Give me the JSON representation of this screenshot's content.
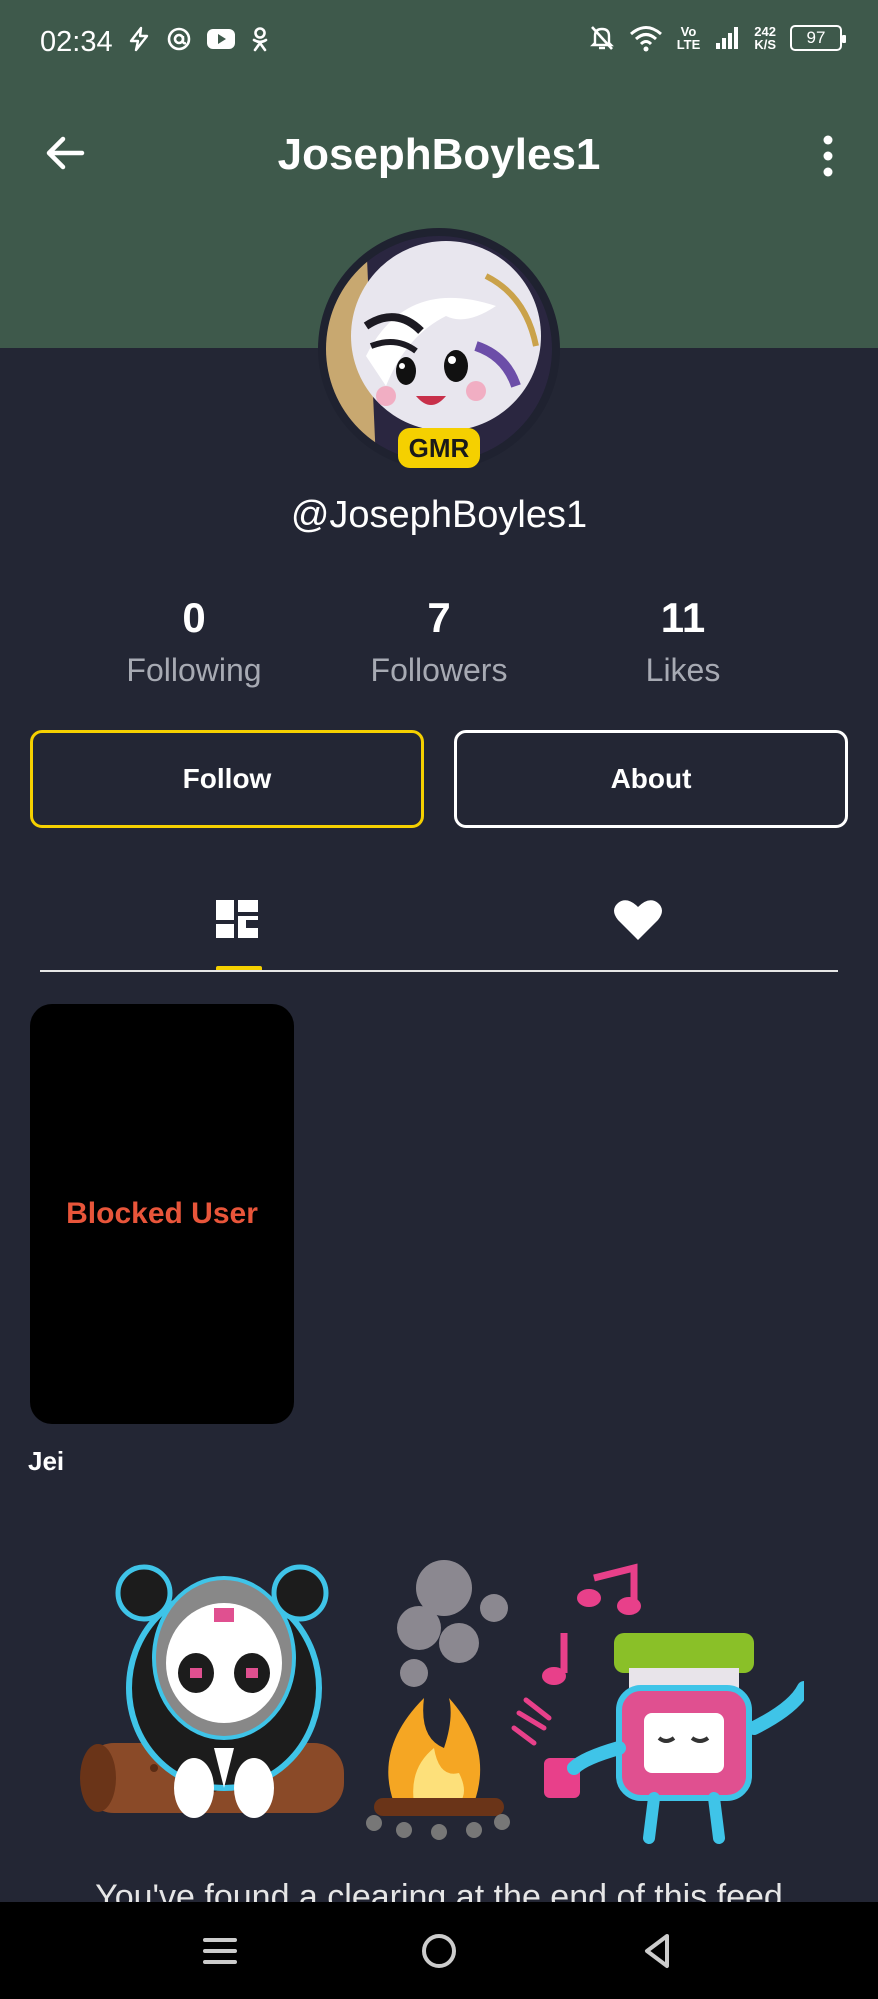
{
  "status_bar": {
    "time": "02:34",
    "network_speed_value": "242",
    "network_speed_unit": "K/S",
    "battery": "97",
    "volte_top": "Vo",
    "volte_bottom": "LTE"
  },
  "header": {
    "title": "JosephBoyles1"
  },
  "profile": {
    "badge": "GMR",
    "handle": "@JosephBoyles1"
  },
  "stats": [
    {
      "value": "0",
      "label": "Following"
    },
    {
      "value": "7",
      "label": "Followers"
    },
    {
      "value": "11",
      "label": "Likes"
    }
  ],
  "actions": {
    "follow_label": "Follow",
    "about_label": "About"
  },
  "tabs": [
    {
      "icon": "grid-icon",
      "active": true
    },
    {
      "icon": "heart-icon",
      "active": false
    }
  ],
  "feed": [
    {
      "overlay_text": "Blocked User",
      "caption": "Jei"
    }
  ],
  "end_message": "You've found a clearing at the end of this feed",
  "colors": {
    "header_bg": "#3e594b",
    "page_bg": "#232634",
    "accent": "#f5d000",
    "blocked_text": "#e8553a"
  }
}
